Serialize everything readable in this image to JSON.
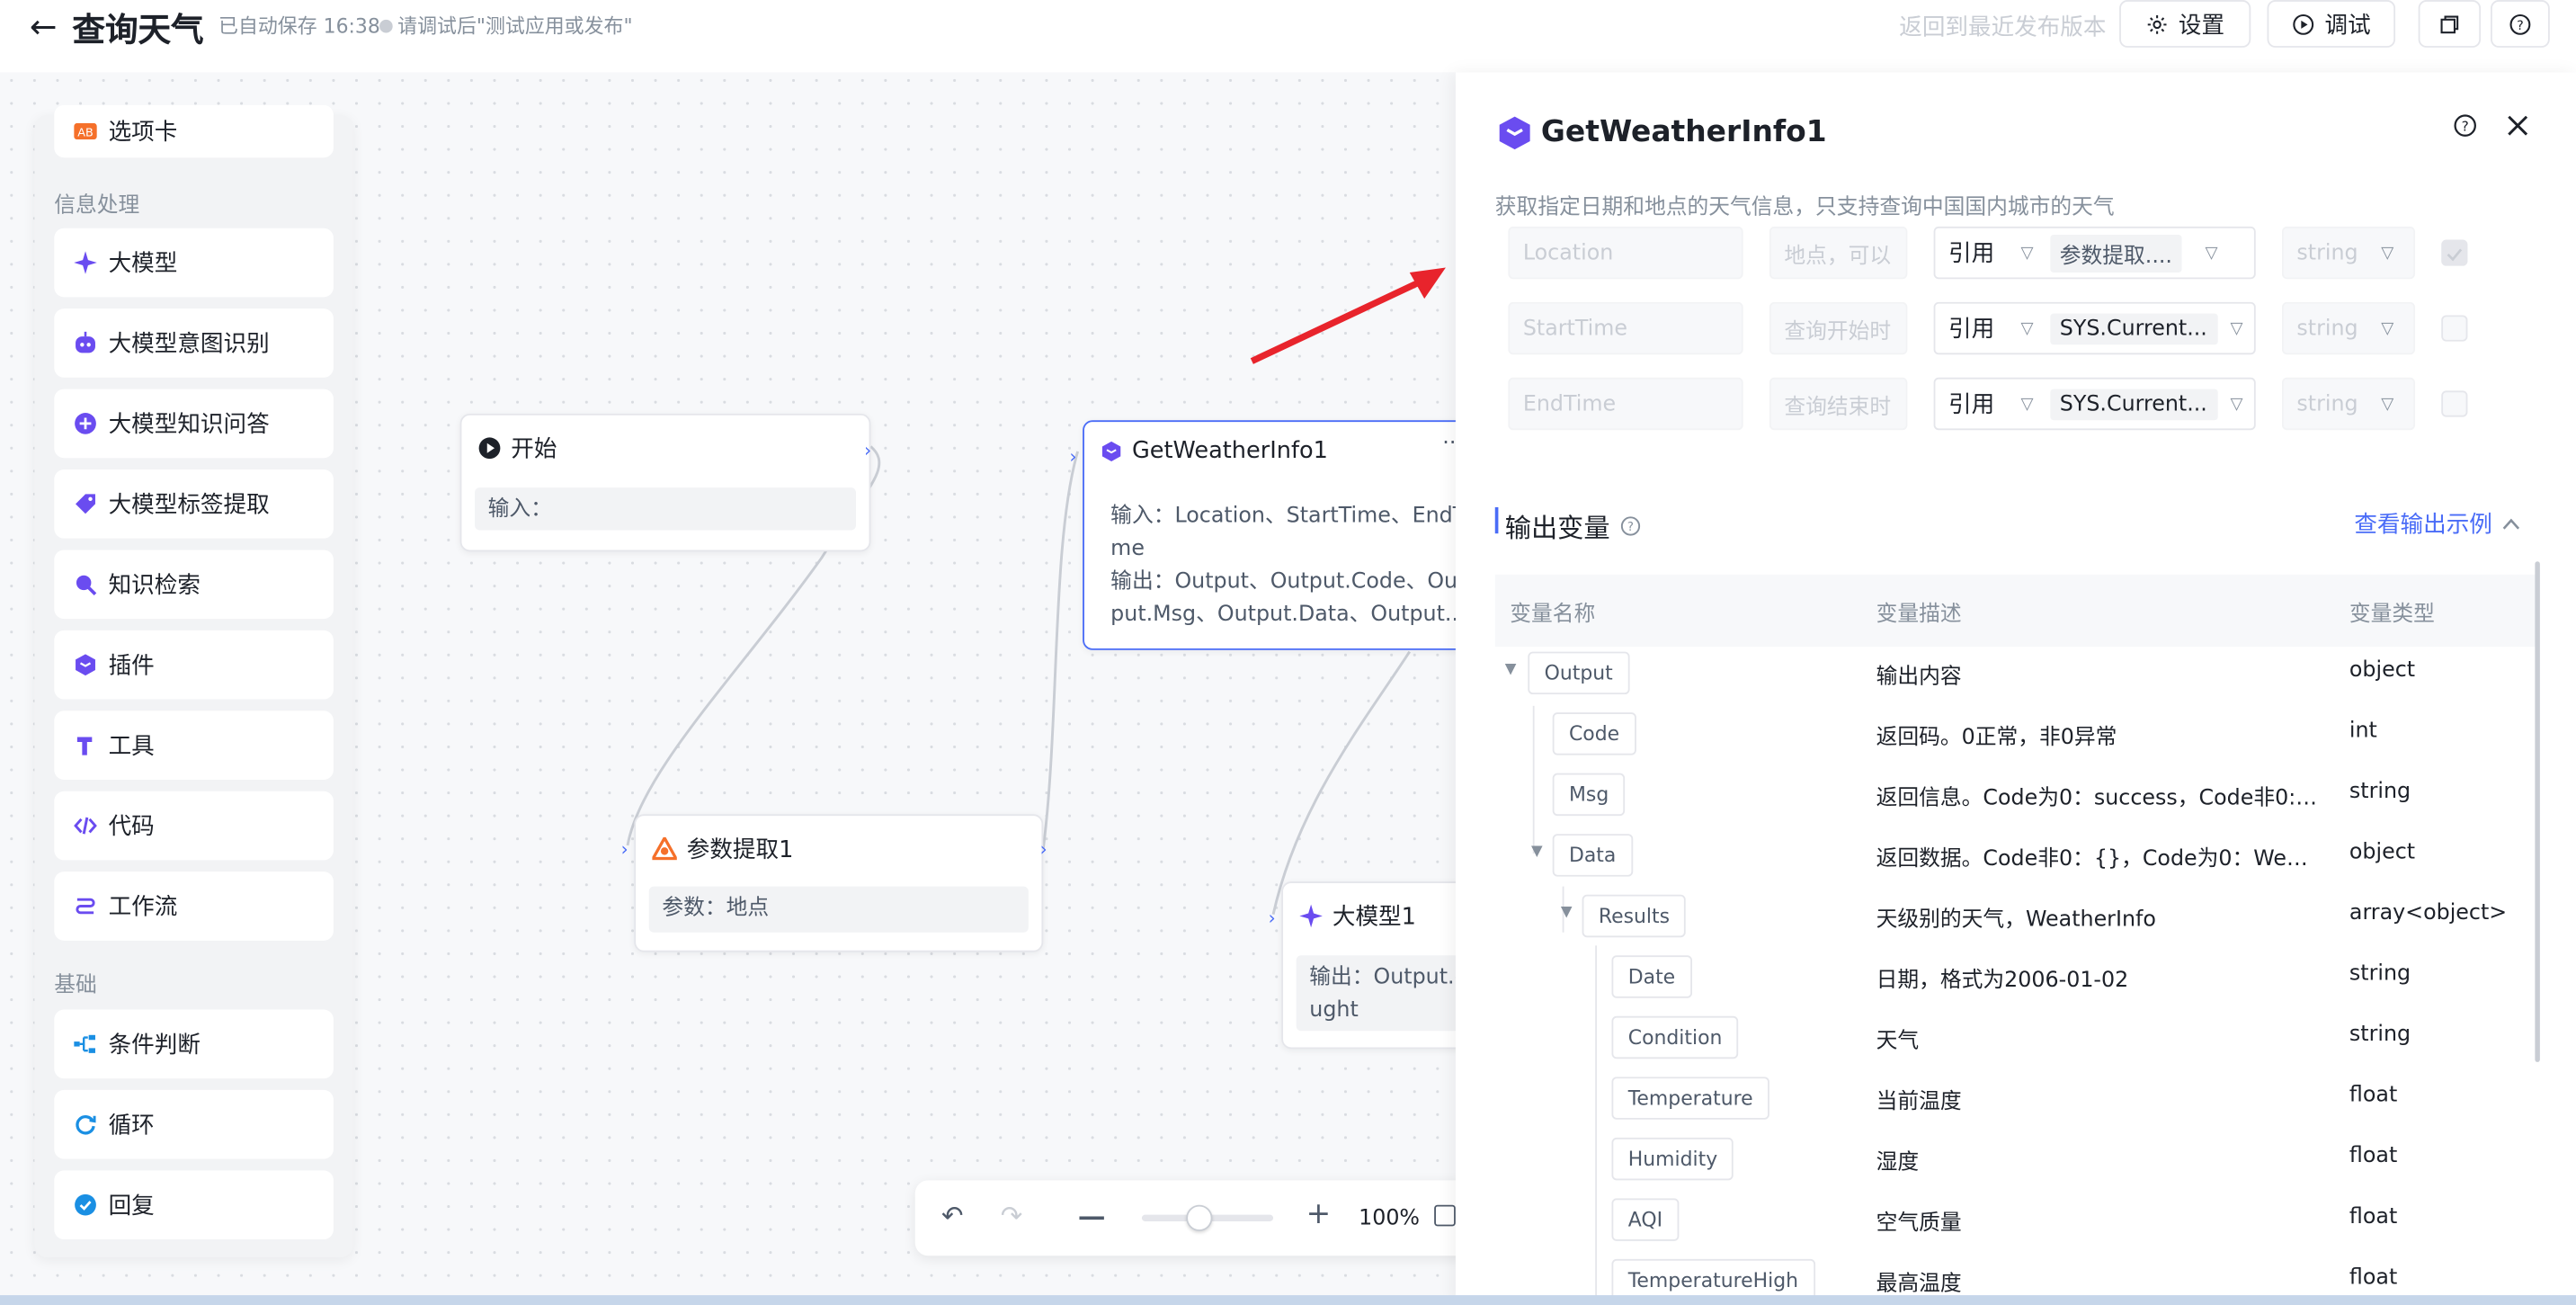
{
  "header": {
    "title": "查询天气",
    "autosave": "已自动保存 16:38",
    "hint": "请调试后\"测试应用或发布\"",
    "revert": "返回到最近发布版本",
    "settings_label": "设置",
    "debug_label": "调试"
  },
  "sidebar": {
    "items_top": [
      {
        "label": "选项卡",
        "icon": "tab-icon"
      }
    ],
    "section_info": "信息处理",
    "items_info": [
      {
        "label": "大模型",
        "icon": "sparkle-icon"
      },
      {
        "label": "大模型意图识别",
        "icon": "robot-icon"
      },
      {
        "label": "大模型知识问答",
        "icon": "plus-circle-icon"
      },
      {
        "label": "大模型标签提取",
        "icon": "tag-icon"
      },
      {
        "label": "知识检索",
        "icon": "search-icon"
      },
      {
        "label": "插件",
        "icon": "cube-icon"
      },
      {
        "label": "工具",
        "icon": "tool-icon"
      },
      {
        "label": "代码",
        "icon": "code-icon"
      },
      {
        "label": "工作流",
        "icon": "workflow-icon"
      }
    ],
    "section_basic": "基础",
    "items_basic": [
      {
        "label": "条件判断",
        "icon": "branch-icon"
      },
      {
        "label": "循环",
        "icon": "loop-icon"
      },
      {
        "label": "回复",
        "icon": "check-circle-icon"
      }
    ]
  },
  "nodes": {
    "start": {
      "title": "开始",
      "body": "输入："
    },
    "param": {
      "title": "参数提取1",
      "body": "参数：地点"
    },
    "weather": {
      "title": "GetWeatherInfo1",
      "input_line1": "输入：Location、StartTime、EndTi",
      "input_line2": "me",
      "output_line1": "输出：Output、Output.Code、Out",
      "output_line2": "put.Msg、Output.Data、Output...."
    },
    "llm": {
      "title": "大模型1",
      "body_line1": "输出：Output.c",
      "body_line2": "ught"
    }
  },
  "zoom": {
    "level": "100%"
  },
  "drawer": {
    "title": "GetWeatherInfo1",
    "description": "获取指定日期和地点的天气信息，只支持查询中国国内城市的天气",
    "params": [
      {
        "name": "Location",
        "desc_placeholder": "地点，可以",
        "mode": "引用",
        "ref": "参数提取....",
        "type": "string",
        "required": true
      },
      {
        "name": "StartTime",
        "desc_placeholder": "查询开始时",
        "mode": "引用",
        "ref": "SYS.Current...",
        "type": "string",
        "required": false
      },
      {
        "name": "EndTime",
        "desc_placeholder": "查询结束时",
        "mode": "引用",
        "ref": "SYS.Current...",
        "type": "string",
        "required": false
      }
    ],
    "output_section": "输出变量",
    "output_example": "查看输出示例",
    "columns": {
      "name": "变量名称",
      "desc": "变量描述",
      "type": "变量类型"
    },
    "variables": [
      {
        "name": "Output",
        "desc": "输出内容",
        "type": "object"
      },
      {
        "name": "Code",
        "desc": "返回码。0正常，非0异常",
        "type": "int"
      },
      {
        "name": "Msg",
        "desc": "返回信息。Code为0：success，Code非0: ...",
        "type": "string"
      },
      {
        "name": "Data",
        "desc": "返回数据。Code非0：{}，Code为0：Weath...",
        "type": "object"
      },
      {
        "name": "Results",
        "desc": "天级别的天气，WeatherInfo",
        "type": "array<object>"
      },
      {
        "name": "Date",
        "desc": "日期，格式为2006-01-02",
        "type": "string"
      },
      {
        "name": "Condition",
        "desc": "天气",
        "type": "string"
      },
      {
        "name": "Temperature",
        "desc": "当前温度",
        "type": "float"
      },
      {
        "name": "Humidity",
        "desc": "湿度",
        "type": "float"
      },
      {
        "name": "AQI",
        "desc": "空气质量",
        "type": "float"
      },
      {
        "name": "TemperatureHigh",
        "desc": "最高温度",
        "type": "float"
      }
    ]
  },
  "colors": {
    "accent": "#4a6cf7",
    "arrow": "#e8242c",
    "plugin": "#6a4cf0",
    "param_node": "#f5702a"
  }
}
